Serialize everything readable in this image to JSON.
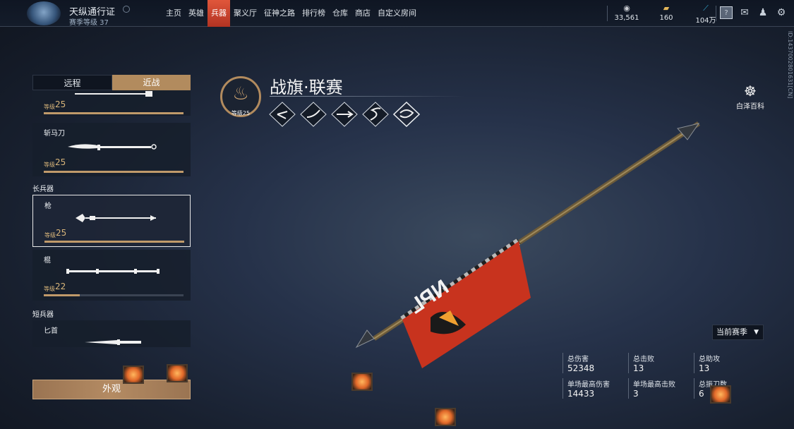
{
  "topbar": {
    "pass_title": "天纵通行证",
    "pass_subtitle": "赛季等级 37",
    "nav": [
      "主页",
      "英雄",
      "兵器",
      "聚义厅",
      "征神之路",
      "排行榜",
      "仓库",
      "商店",
      "自定义房间"
    ],
    "nav_active_index": 2,
    "resources": [
      {
        "icon": "coin-icon",
        "value": "33,561"
      },
      {
        "icon": "ticket-icon",
        "value": "160"
      },
      {
        "icon": "gold-icon",
        "value": "104万"
      }
    ]
  },
  "side_id": "ID:1437002801631[CN]",
  "tabs": {
    "ranged": "远程",
    "melee": "近战",
    "active": "melee"
  },
  "weapons": {
    "level_label": "等级",
    "partial_top": {
      "level": "25",
      "progress": 1.0
    },
    "zhanmadao": {
      "name": "斩马刀",
      "level": "25",
      "progress": 1.0
    },
    "category_long": "长兵器",
    "qiang": {
      "name": "枪",
      "level": "25",
      "progress": 1.0
    },
    "gun": {
      "name": "棍",
      "level": "22",
      "progress": 0.26
    },
    "category_short": "短兵器",
    "bishou": {
      "name": "匕首"
    }
  },
  "appearance_button": "外观",
  "weapon_detail": {
    "title": "战旗·联赛",
    "emblem_level": "等级25",
    "skills": [
      "skill-1-icon",
      "skill-2-icon",
      "skill-3-icon",
      "skill-4-icon",
      "skill-5-icon"
    ]
  },
  "baize": {
    "label": "白泽百科"
  },
  "season_select": {
    "value": "当前赛季"
  },
  "stats": {
    "total_damage_label": "总伤害",
    "total_damage": "52348",
    "total_kills_label": "总击败",
    "total_kills": "13",
    "total_assists_label": "总助攻",
    "total_assists": "13",
    "max_damage_label": "单场最高伤害",
    "max_damage": "14433",
    "max_kills_label": "单场最高击败",
    "max_kills": "3",
    "total_shake_label": "总振刀数",
    "total_shake": "6"
  },
  "flag_text": "NPL",
  "colors": {
    "accent": "#b28b5e",
    "nav_active": "#c83e28",
    "level_gold": "#d8b57a"
  }
}
